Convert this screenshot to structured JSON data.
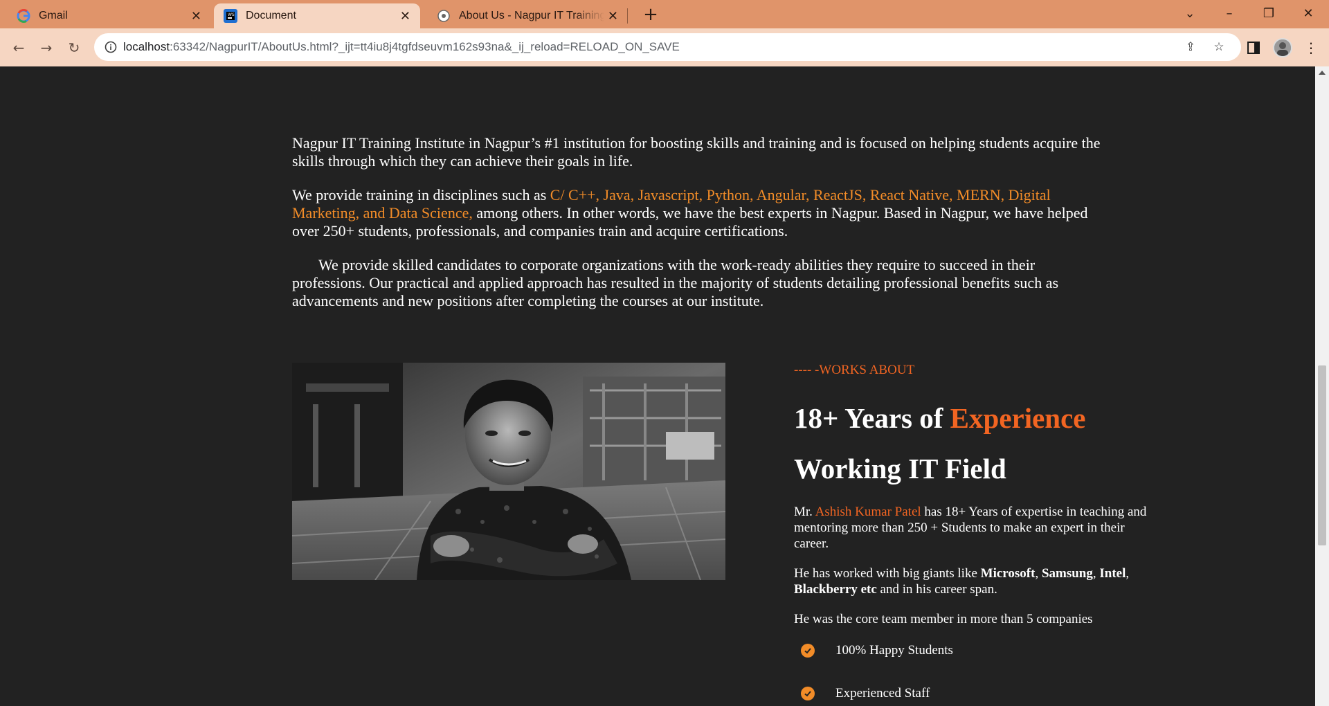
{
  "tabs": [
    {
      "label": "Gmail",
      "icon": "gmail-icon"
    },
    {
      "label": "Document",
      "icon": "intellij-icon"
    },
    {
      "label": "About Us - Nagpur IT Training In",
      "icon": "site-icon"
    }
  ],
  "address_bar": {
    "host": "localhost",
    "path": ":63342/NagpurIT/AboutUs.html?_ijt=tt4iu8j4tgfdseuvm162s93na&_ij_reload=RELOAD_ON_SAVE"
  },
  "intro": {
    "p1": "Nagpur IT Training Institute in Nagpur’s #1 institution for boosting skills and training and is focused on helping students acquire the skills through which they can achieve their goals in life.",
    "p2_before": "We provide training in disciplines such as ",
    "p2_highlight": "C/ C++, Java, Javascript, Python, Angular, ReactJS, React Native, MERN, Digital Marketing, and Data Science,",
    "p2_after": " among others. In other words, we have the best experts in Nagpur. Based in Nagpur, we have helped over 250+ students, professionals, and companies train and acquire certifications.",
    "p3": "We provide skilled candidates to corporate organizations with the work-ready abilities they require to succeed in their professions. Our practical and applied approach has resulted in the majority of students detailing professional benefits such as advancements and new positions after completing the courses at our institute."
  },
  "about": {
    "kicker": "---- -WORKS ABOUT",
    "headline_part1": "18+ Years of ",
    "headline_highlight": "Experience",
    "headline_line2": "Working IT Field",
    "bio1_prefix": "Mr. ",
    "bio1_name": "Ashish Kumar Patel",
    "bio1_suffix": " has 18+ Years of expertise in teaching and mentoring more than 250 + Students to make an expert in their career.",
    "bio2_prefix": "He has worked with big giants like ",
    "bio2_c1": "Microsoft",
    "bio2_sep1": ", ",
    "bio2_c2": "Samsung",
    "bio2_sep2": ", ",
    "bio2_c3": "Intel",
    "bio2_sep3": ", ",
    "bio2_c4": "Blackberry etc",
    "bio2_suffix": " and in his career span.",
    "bio3": "He was the core team member in more than 5 companies",
    "features": [
      "100% Happy Students",
      "Experienced Staff"
    ]
  },
  "colors": {
    "accent": "#f26522",
    "page_bg": "#222222",
    "tabstrip": "#e0946a"
  }
}
